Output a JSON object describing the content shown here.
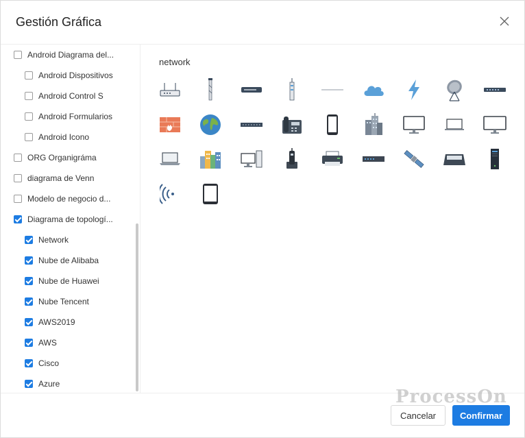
{
  "dialog": {
    "title": "Gestión Gráfica",
    "close_icon": "close-icon"
  },
  "sidebar": {
    "items": [
      {
        "label": "Android Diagrama del...",
        "checked": false,
        "indent": 0
      },
      {
        "label": "Android Dispositivos",
        "checked": false,
        "indent": 1
      },
      {
        "label": "Android Control S",
        "checked": false,
        "indent": 1
      },
      {
        "label": "Android Formularios",
        "checked": false,
        "indent": 1
      },
      {
        "label": "Android Icono",
        "checked": false,
        "indent": 1
      },
      {
        "label": "ORG Organigráma",
        "checked": false,
        "indent": 0
      },
      {
        "label": "diagrama de Venn",
        "checked": false,
        "indent": 0
      },
      {
        "label": "Modelo de negocio d...",
        "checked": false,
        "indent": 0
      },
      {
        "label": "Diagrama de topologí...",
        "checked": true,
        "indent": 0
      },
      {
        "label": "Network",
        "checked": true,
        "indent": 1
      },
      {
        "label": "Nube de Alibaba",
        "checked": true,
        "indent": 1
      },
      {
        "label": "Nube de Huawei",
        "checked": true,
        "indent": 1
      },
      {
        "label": "Nube Tencent",
        "checked": true,
        "indent": 1
      },
      {
        "label": "AWS2019",
        "checked": true,
        "indent": 1
      },
      {
        "label": "AWS",
        "checked": true,
        "indent": 1
      },
      {
        "label": "Cisco",
        "checked": true,
        "indent": 1
      },
      {
        "label": "Azure",
        "checked": true,
        "indent": 1
      }
    ]
  },
  "content": {
    "section_title": "network",
    "icons": [
      "router-icon",
      "antenna-icon",
      "switch-icon",
      "tower-icon",
      "cable-icon",
      "cloud-icon",
      "lightning-icon",
      "satellite-dish-icon",
      "hub-icon",
      "firewall-icon",
      "globe-icon",
      "patch-panel-icon",
      "fax-icon",
      "smartphone-icon",
      "office-building-icon",
      "monitor-icon",
      "laptop-icon",
      "imac-icon",
      "laptop-open-icon",
      "city-buildings-icon",
      "workstation-icon",
      "cordless-phone-icon",
      "printer-icon",
      "rack-switch-icon",
      "satellite-icon",
      "scanner-icon",
      "server-tower-icon",
      "wireless-signal-icon",
      "tablet-icon"
    ]
  },
  "footer": {
    "cancel_label": "Cancelar",
    "confirm_label": "Confirmar",
    "watermark": "ProcessOn"
  },
  "colors": {
    "accent": "#1d7ce2",
    "icon_dark": "#3a4a5c",
    "icon_blue": "#5aa0d8"
  }
}
